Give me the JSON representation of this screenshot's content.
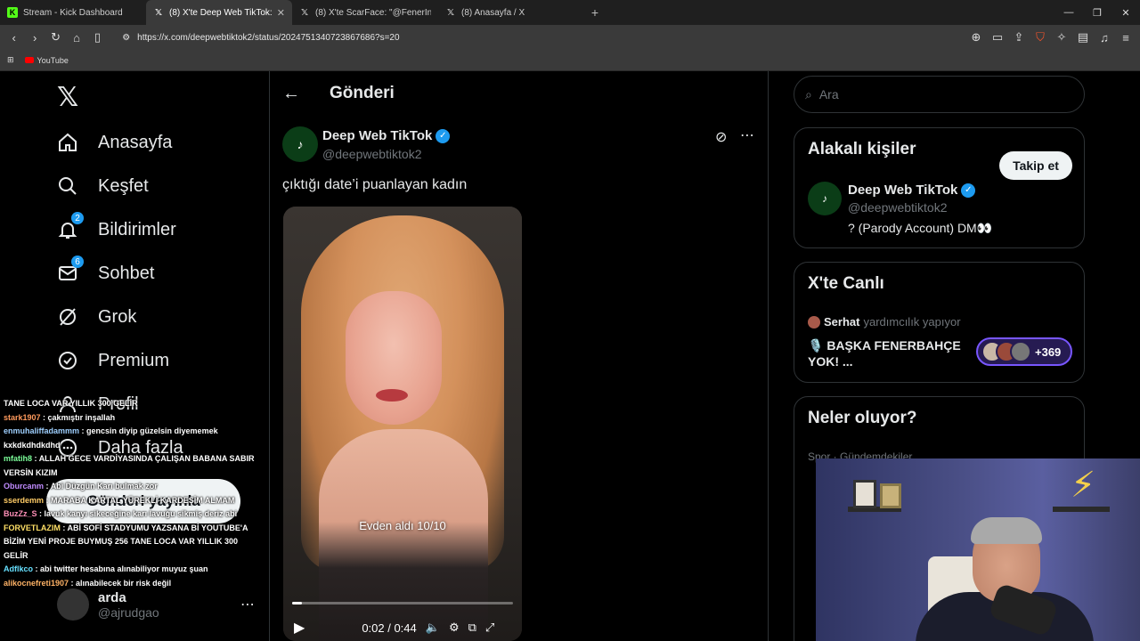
{
  "browser": {
    "tabs": [
      {
        "title": "Stream - Kick Dashboard",
        "fav": "K",
        "active": false
      },
      {
        "title": "(8) X'te Deep Web TikTok: \"çıktığ",
        "fav": "𝕏",
        "active": true
      },
      {
        "title": "(8) X'te ScarFace: \"@FenerInstant ? K",
        "fav": "𝕏",
        "active": false
      },
      {
        "title": "(8) Anasayfa / X",
        "fav": "𝕏",
        "active": false
      }
    ],
    "url": "https://x.com/deepwebtiktok2/status/2024751340723867686?s=20",
    "bookmark": "YouTube"
  },
  "leftnav": {
    "logo": "𝕏",
    "items": [
      {
        "label": "Anasayfa",
        "icon": "home-icon",
        "glyph": "⌂",
        "badge": ""
      },
      {
        "label": "Keşfet",
        "icon": "search-icon",
        "glyph": "⌕",
        "badge": ""
      },
      {
        "label": "Bildirimler",
        "icon": "bell-icon",
        "glyph": "🔔",
        "badge": "2"
      },
      {
        "label": "Sohbet",
        "icon": "mail-icon",
        "glyph": "✉",
        "badge": "6"
      },
      {
        "label": "Grok",
        "icon": "grok-icon",
        "glyph": "⊘",
        "badge": ""
      },
      {
        "label": "Premium",
        "icon": "premium-icon",
        "glyph": "✪",
        "badge": ""
      },
      {
        "label": "Profil",
        "icon": "profile-icon",
        "glyph": "☺",
        "badge": ""
      },
      {
        "label": "Daha fazla",
        "icon": "more-icon",
        "glyph": "⋯",
        "badge": ""
      }
    ],
    "post_button": "Gönderi yayınla",
    "user": {
      "name": "arda",
      "handle": "@ajrudgao"
    }
  },
  "post": {
    "header_title": "Gönderi",
    "author_name": "Deep Web TikTok",
    "author_handle": "@deepwebtiktok2",
    "text": "çıktığı date’i puanlayan kadın",
    "video": {
      "caption": "Evden aldı 10/10",
      "time": "0:02 / 0:44",
      "progress": 0.045
    }
  },
  "sidebar": {
    "search_placeholder": "Ara",
    "related": {
      "title": "Alakalı kişiler",
      "name": "Deep Web TikTok",
      "handle": "@deepwebtiktok2",
      "bio": "? (Parody Account) DM👀",
      "follow_label": "Takip et"
    },
    "live": {
      "title": "X'te Canlı",
      "host": "Serhat",
      "host_action": "yardımcılık yapıyor",
      "space_title": "🎙️ BAŞKA FENERBAHÇE YOK! ...",
      "listeners": "+369"
    },
    "trends": {
      "title": "Neler oluyor?",
      "subtitle": "Spor · Gündemdekiler"
    }
  },
  "chat": [
    {
      "user": "",
      "color": "#ffffff",
      "text": "TANE LOCA VAR YILLIK 300 GELİR"
    },
    {
      "user": "stark1907",
      "color": "#ff9a5c",
      "text": "çakmıştır inşallah"
    },
    {
      "user": "enmuhaliffadammm",
      "color": "#9fd0ff",
      "text": "gencsin diyip güzelsin diyememek kxkdkdhdkdhd"
    },
    {
      "user": "mfatih8",
      "color": "#7cff9a",
      "text": "ALLAH GECE VARDİYASINDA ÇALIŞAN BABANA SABIR VERSİN KIZIM"
    },
    {
      "user": "Oburcanm",
      "color": "#c08bff",
      "text": "Abi Düzgün Karı bulmak zor"
    },
    {
      "user": "sserdemm",
      "color": "#ffcc66",
      "text": "MARABA KARTAL YÜREKLİ KARDEŞİM ALMAM"
    },
    {
      "user": "BuzZz_S",
      "color": "#ff8fb8",
      "text": "lavuk kanyı sikeceğine karı lavuğu sikmiş deriz abi"
    },
    {
      "user": "FORVETLAZIM",
      "color": "#ffe066",
      "text": "ABİ SOFİ STADYUMU YAZSANA Bİ YOUTUBE'A BİZİM YENİ PROJE BUYMUŞ 256 TANE LOCA VAR YILLIK 300 GELİR"
    },
    {
      "user": "Adflkco",
      "color": "#66e0ff",
      "text": "abi twitter hesabına alınabiliyor muyuz şuan"
    },
    {
      "user": "alikocnefreti1907",
      "color": "#ffb366",
      "text": "alınabilecek bir risk değil"
    }
  ]
}
